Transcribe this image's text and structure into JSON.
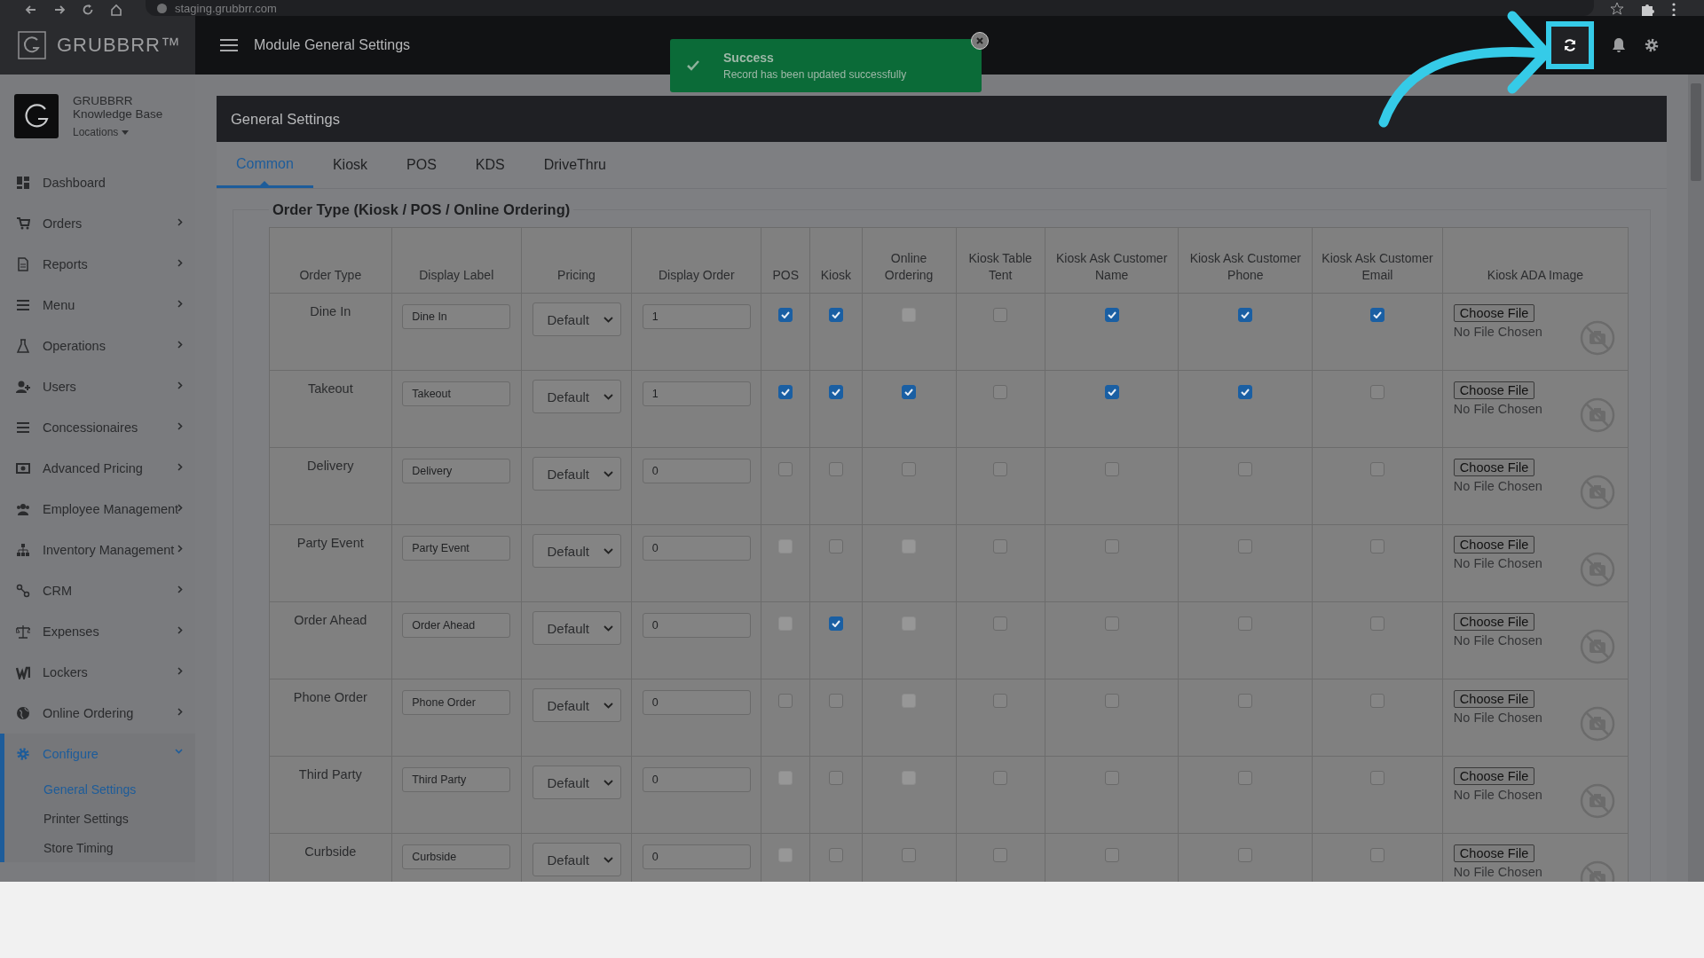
{
  "browser": {
    "url": "staging.grubbrr.com"
  },
  "header": {
    "brand": "GRUBBRR™",
    "title": "Module General Settings"
  },
  "toast": {
    "title": "Success",
    "message": "Record has been updated successfully"
  },
  "profile": {
    "name": "GRUBBRR",
    "subtitle": "Knowledge Base",
    "locations": "Locations"
  },
  "sidebar": {
    "items": [
      {
        "label": "Dashboard",
        "expandable": false,
        "selected": false
      },
      {
        "label": "Orders",
        "expandable": true,
        "expanded": false,
        "selected": false
      },
      {
        "label": "Reports",
        "expandable": true,
        "expanded": false,
        "selected": false
      },
      {
        "label": "Menu",
        "expandable": true,
        "expanded": false,
        "selected": false
      },
      {
        "label": "Operations",
        "expandable": true,
        "expanded": false,
        "selected": false
      },
      {
        "label": "Users",
        "expandable": true,
        "expanded": false,
        "selected": false
      },
      {
        "label": "Concessionaires",
        "expandable": true,
        "expanded": false,
        "selected": false
      },
      {
        "label": "Advanced Pricing",
        "expandable": true,
        "expanded": false,
        "selected": false
      },
      {
        "label": "Employee Management",
        "expandable": true,
        "expanded": false,
        "selected": false
      },
      {
        "label": "Inventory Management",
        "expandable": true,
        "expanded": false,
        "selected": false
      },
      {
        "label": "CRM",
        "expandable": true,
        "expanded": false,
        "selected": false
      },
      {
        "label": "Expenses",
        "expandable": true,
        "expanded": false,
        "selected": false
      },
      {
        "label": "Lockers",
        "expandable": true,
        "expanded": false,
        "selected": false
      },
      {
        "label": "Online Ordering",
        "expandable": true,
        "expanded": false,
        "selected": false
      },
      {
        "label": "Configure",
        "expandable": true,
        "expanded": true,
        "selected": true,
        "children": [
          {
            "label": "General Settings",
            "selected": true
          },
          {
            "label": "Printer Settings",
            "selected": false
          },
          {
            "label": "Store Timing",
            "selected": false
          }
        ]
      }
    ]
  },
  "card": {
    "title": "General Settings",
    "tabs": [
      {
        "label": "Common",
        "selected": true
      },
      {
        "label": "Kiosk",
        "selected": false
      },
      {
        "label": "POS",
        "selected": false
      },
      {
        "label": "KDS",
        "selected": false
      },
      {
        "label": "DriveThru",
        "selected": false
      }
    ]
  },
  "section": {
    "legend": "Order Type (Kiosk / POS / Online Ordering)"
  },
  "table": {
    "columns": [
      "Order Type",
      "Display Label",
      "Pricing",
      "Display Order",
      "POS",
      "Kiosk",
      "Online Ordering",
      "Kiosk Table Tent",
      "Kiosk Ask Customer Name",
      "Kiosk Ask Customer Phone",
      "Kiosk Ask Customer Email",
      "Kiosk ADA Image"
    ],
    "rows": [
      {
        "order_type": "Dine In",
        "display_label": "Dine In",
        "pricing": "Default",
        "display_order": "1",
        "checks": [
          {
            "checked": true,
            "disabled": false
          },
          {
            "checked": true,
            "disabled": false
          },
          {
            "checked": false,
            "disabled": true
          },
          {
            "checked": false,
            "disabled": false
          },
          {
            "checked": true,
            "disabled": false
          },
          {
            "checked": true,
            "disabled": false
          },
          {
            "checked": true,
            "disabled": false
          }
        ],
        "file_button": "Choose File",
        "file_status": "No File Chosen"
      },
      {
        "order_type": "Takeout",
        "display_label": "Takeout",
        "pricing": "Default",
        "display_order": "1",
        "checks": [
          {
            "checked": true,
            "disabled": false
          },
          {
            "checked": true,
            "disabled": false
          },
          {
            "checked": true,
            "disabled": false
          },
          {
            "checked": false,
            "disabled": false
          },
          {
            "checked": true,
            "disabled": false
          },
          {
            "checked": true,
            "disabled": false
          },
          {
            "checked": false,
            "disabled": false
          }
        ],
        "file_button": "Choose File",
        "file_status": "No File Chosen"
      },
      {
        "order_type": "Delivery",
        "display_label": "Delivery",
        "pricing": "Default",
        "display_order": "0",
        "checks": [
          {
            "checked": false,
            "disabled": false
          },
          {
            "checked": false,
            "disabled": false
          },
          {
            "checked": false,
            "disabled": false
          },
          {
            "checked": false,
            "disabled": false
          },
          {
            "checked": false,
            "disabled": false
          },
          {
            "checked": false,
            "disabled": false
          },
          {
            "checked": false,
            "disabled": false
          }
        ],
        "file_button": "Choose File",
        "file_status": "No File Chosen"
      },
      {
        "order_type": "Party Event",
        "display_label": "Party Event",
        "pricing": "Default",
        "display_order": "0",
        "checks": [
          {
            "checked": false,
            "disabled": true
          },
          {
            "checked": false,
            "disabled": false
          },
          {
            "checked": false,
            "disabled": true
          },
          {
            "checked": false,
            "disabled": false
          },
          {
            "checked": false,
            "disabled": false
          },
          {
            "checked": false,
            "disabled": false
          },
          {
            "checked": false,
            "disabled": false
          }
        ],
        "file_button": "Choose File",
        "file_status": "No File Chosen"
      },
      {
        "order_type": "Order Ahead",
        "display_label": "Order Ahead",
        "pricing": "Default",
        "display_order": "0",
        "checks": [
          {
            "checked": false,
            "disabled": true
          },
          {
            "checked": true,
            "disabled": false
          },
          {
            "checked": false,
            "disabled": true
          },
          {
            "checked": false,
            "disabled": false
          },
          {
            "checked": false,
            "disabled": false
          },
          {
            "checked": false,
            "disabled": false
          },
          {
            "checked": false,
            "disabled": false
          }
        ],
        "file_button": "Choose File",
        "file_status": "No File Chosen"
      },
      {
        "order_type": "Phone Order",
        "display_label": "Phone Order",
        "pricing": "Default",
        "display_order": "0",
        "checks": [
          {
            "checked": false,
            "disabled": false
          },
          {
            "checked": false,
            "disabled": false
          },
          {
            "checked": false,
            "disabled": true
          },
          {
            "checked": false,
            "disabled": false
          },
          {
            "checked": false,
            "disabled": false
          },
          {
            "checked": false,
            "disabled": false
          },
          {
            "checked": false,
            "disabled": false
          }
        ],
        "file_button": "Choose File",
        "file_status": "No File Chosen"
      },
      {
        "order_type": "Third Party",
        "display_label": "Third Party",
        "pricing": "Default",
        "display_order": "0",
        "checks": [
          {
            "checked": false,
            "disabled": true
          },
          {
            "checked": false,
            "disabled": false
          },
          {
            "checked": false,
            "disabled": true
          },
          {
            "checked": false,
            "disabled": false
          },
          {
            "checked": false,
            "disabled": false
          },
          {
            "checked": false,
            "disabled": false
          },
          {
            "checked": false,
            "disabled": false
          }
        ],
        "file_button": "Choose File",
        "file_status": "No File Chosen"
      },
      {
        "order_type": "Curbside",
        "display_label": "Curbside",
        "pricing": "Default",
        "display_order": "0",
        "checks": [
          {
            "checked": false,
            "disabled": true
          },
          {
            "checked": false,
            "disabled": false
          },
          {
            "checked": false,
            "disabled": false
          },
          {
            "checked": false,
            "disabled": false
          },
          {
            "checked": false,
            "disabled": false
          },
          {
            "checked": false,
            "disabled": false
          },
          {
            "checked": false,
            "disabled": false
          }
        ],
        "file_button": "Choose File",
        "file_status": "No File Chosen"
      }
    ]
  }
}
